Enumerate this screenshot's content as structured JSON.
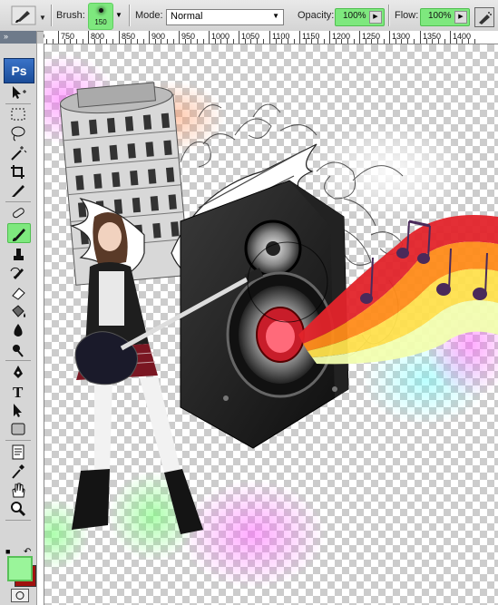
{
  "options_bar": {
    "brush_label": "Brush:",
    "brush_size": "150",
    "mode_label": "Mode:",
    "mode_value": "Normal",
    "opacity_label": "Opacity:",
    "opacity_value": "100%",
    "flow_label": "Flow:",
    "flow_value": "100%"
  },
  "ruler": {
    "ticks": [
      "700",
      "750",
      "800",
      "850",
      "900",
      "950",
      "1000",
      "1050",
      "1100",
      "1150",
      "1200",
      "1250",
      "1300",
      "1350",
      "1400"
    ]
  },
  "toolbox": {
    "logo": "Ps",
    "tools": [
      "move-tool",
      "marquee-tool",
      "lasso-tool",
      "magic-wand-tool",
      "crop-tool",
      "slice-tool",
      "healing-brush-tool",
      "brush-tool",
      "clone-stamp-tool",
      "history-brush-tool",
      "eraser-tool",
      "paint-bucket-tool",
      "blur-tool",
      "dodge-tool",
      "pen-tool",
      "type-tool",
      "path-selection-tool",
      "shape-tool",
      "notes-tool",
      "eyedropper-tool",
      "hand-tool",
      "zoom-tool"
    ],
    "active_tool": "brush-tool",
    "foreground_color": "#9af59a",
    "background_color": "#a0120e"
  },
  "colors": {
    "highlight": "#7ee87e"
  }
}
